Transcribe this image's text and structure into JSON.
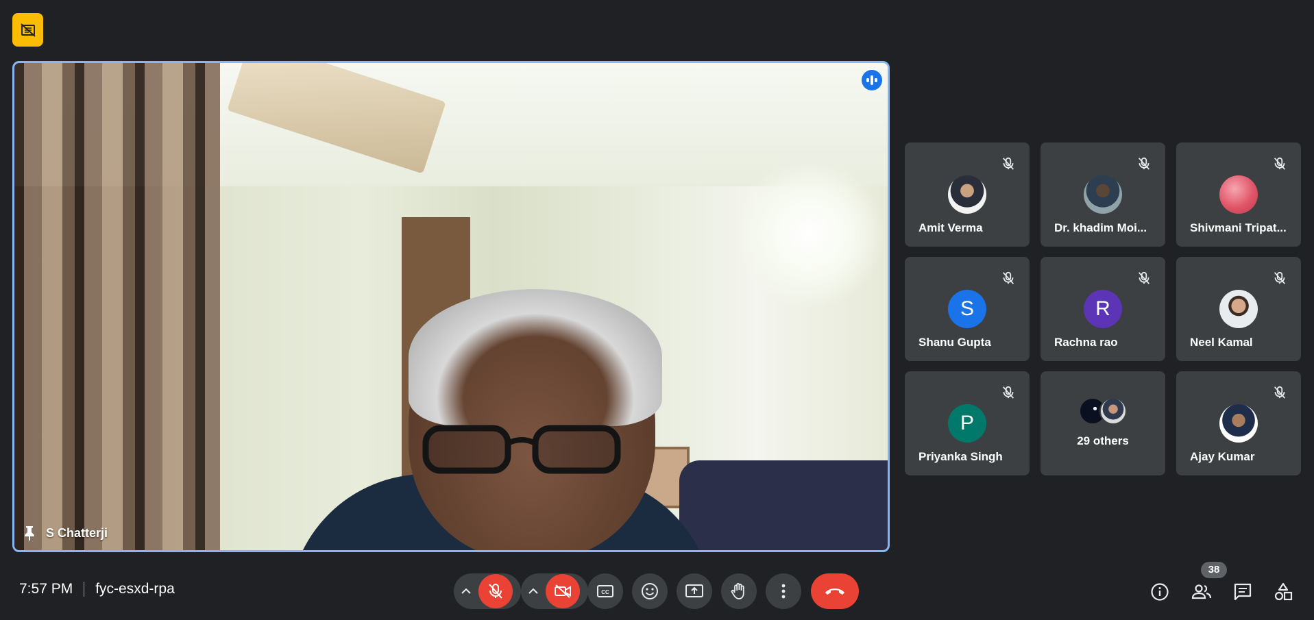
{
  "main_speaker": {
    "name": "S Chatterji"
  },
  "participants": [
    {
      "name": "Amit Verma",
      "avatar_type": "photo",
      "muted": true
    },
    {
      "name": "Dr. khadim Moi...",
      "avatar_type": "photo",
      "muted": true
    },
    {
      "name": "Shivmani Tripat...",
      "avatar_type": "photo",
      "muted": true
    },
    {
      "name": "Shanu Gupta",
      "avatar_type": "letter",
      "letter": "S",
      "color": "#1a73e8",
      "muted": true
    },
    {
      "name": "Rachna rao",
      "avatar_type": "letter",
      "letter": "R",
      "color": "#5b35b5",
      "muted": true
    },
    {
      "name": "Neel Kamal",
      "avatar_type": "photo",
      "muted": true
    },
    {
      "name": "Priyanka Singh",
      "avatar_type": "letter",
      "letter": "P",
      "color": "#00796b",
      "muted": true
    },
    {
      "name": "29 others",
      "avatar_type": "group",
      "muted": false
    },
    {
      "name": "Ajay Kumar",
      "avatar_type": "photo",
      "muted": true
    }
  ],
  "footer": {
    "time": "7:57 PM",
    "meeting_code": "fyc-esxd-rpa",
    "participant_count": "38"
  },
  "icons": {
    "top_badge": "no-video-feed-icon",
    "speaking": "speaking-indicator-icon",
    "pin": "pin-icon",
    "mic_off": "mic-off-icon"
  },
  "colors": {
    "background": "#202124",
    "tile": "#3c4043",
    "accent_red": "#ea4335",
    "active_border": "#8ab4f8",
    "badge_yellow": "#fbbc04"
  }
}
